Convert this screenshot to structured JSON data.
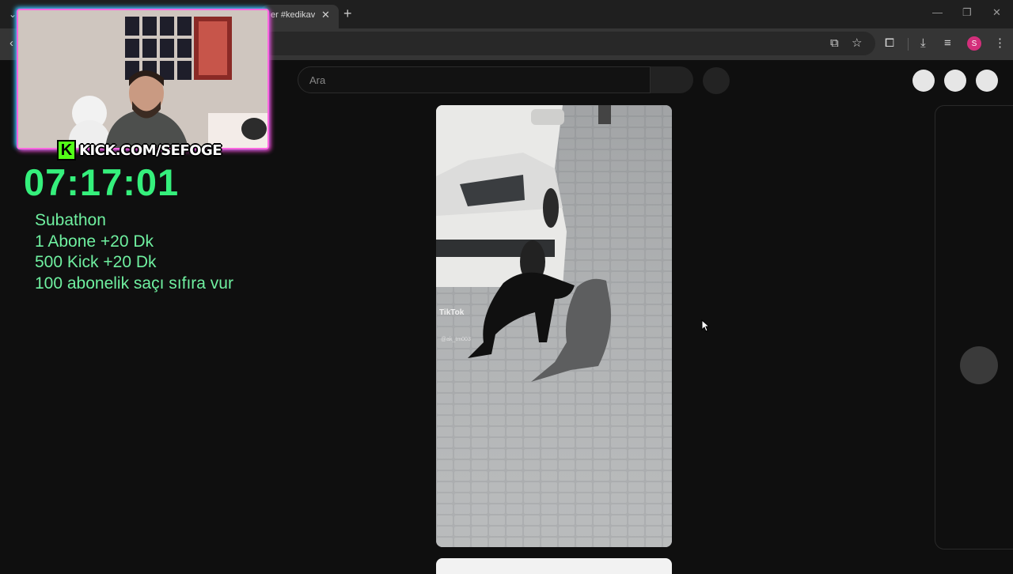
{
  "browser": {
    "tab_title": "er #kedikav",
    "tab_close": "✕",
    "new_tab": "+",
    "avatar_initial": "S"
  },
  "page": {
    "search_placeholder": "Ara"
  },
  "video": {
    "watermark_brand": "TikTok",
    "watermark_user": "@ak_tm003"
  },
  "overlay": {
    "kick_url": "KICK.COM/SEFOGE",
    "timer": "07:17:01",
    "lines": [
      "Subathon",
      "1 Abone +20 Dk",
      "500 Kick +20 Dk",
      "100 abonelik saçı sıfıra vur"
    ],
    "accent_green": "#35f07c",
    "kick_green": "#53fc18"
  }
}
